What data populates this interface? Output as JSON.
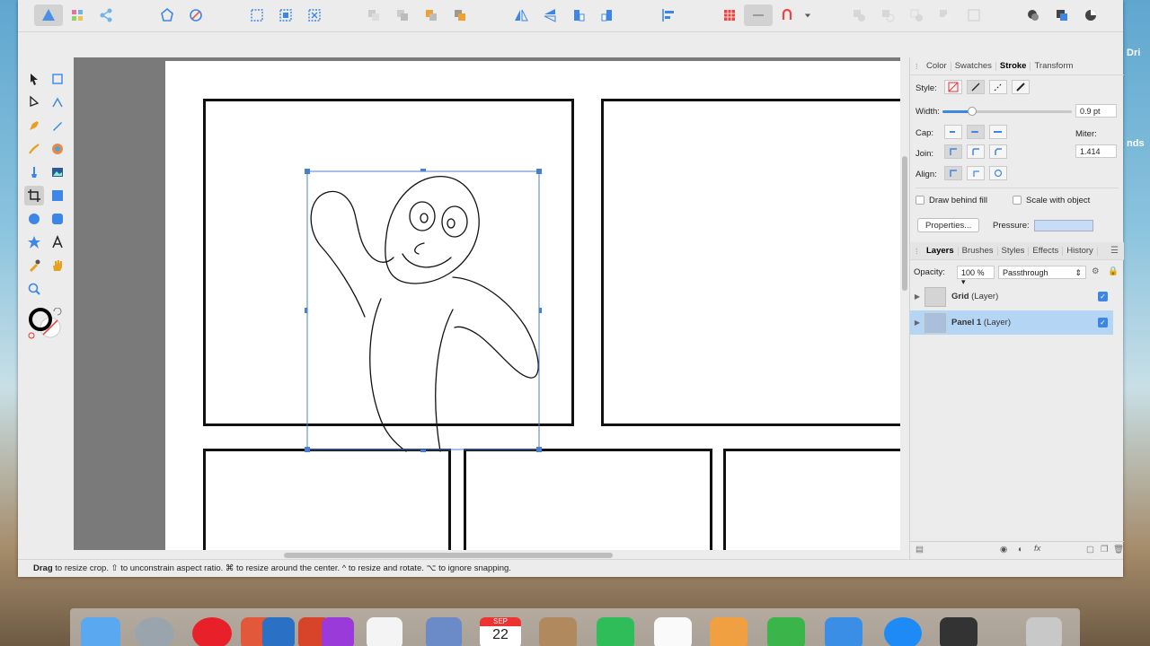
{
  "desktop": {
    "right_text_1": "Dri",
    "right_text_2": "nds"
  },
  "toolbar": {
    "icons": [
      "affinity-designer-icon",
      "pixel-persona-icon",
      "export-persona-icon",
      "assistant-icon",
      "preferences-icon",
      "snapping-icon",
      "isolate-icon",
      "align-icon",
      "arrange-icon",
      "flip-icon",
      "boolean-icon",
      "insert-icon"
    ]
  },
  "tools": [
    "move-tool-icon",
    "artboard-tool-icon",
    "node-tool-icon",
    "corner-tool-icon",
    "pen-tool-icon",
    "pencil-tool-icon",
    "vector-brush-icon",
    "color-picker-icon",
    "fill-tool-icon",
    "place-image-icon",
    "crop-tool-icon",
    "rectangle-tool-icon",
    "ellipse-tool-icon",
    "rounded-rectangle-icon",
    "star-tool-icon",
    "text-tool-icon",
    "eyedropper-icon",
    "hand-tool-icon",
    "zoom-tool-icon"
  ],
  "status": {
    "bold": "Drag",
    "text": " to resize crop. ⇧ to unconstrain aspect ratio. ⌘ to resize around the center. ^ to resize and rotate. ⌥ to ignore snapping."
  },
  "stroke_panel": {
    "tabs": [
      "Color",
      "Swatches",
      "Stroke",
      "Transform"
    ],
    "selected_tab": "Stroke",
    "style_label": "Style:",
    "width_label": "Width:",
    "width_value": "0.9 pt",
    "width_fraction": 0.23,
    "cap_label": "Cap:",
    "join_label": "Join:",
    "align_label": "Align:",
    "miter_label": "Miter:",
    "miter_value": "1.414",
    "draw_behind_fill": "Draw behind fill",
    "scale_with_object": "Scale with object",
    "properties_button": "Properties...",
    "pressure_label": "Pressure:"
  },
  "layers_panel": {
    "tabs": [
      "Layers",
      "Brushes",
      "Styles",
      "Effects",
      "History"
    ],
    "selected_tab": "Layers",
    "opacity_label": "Opacity:",
    "opacity_value": "100 %",
    "blend_mode": "Passthrough",
    "layers": [
      {
        "name": "Grid",
        "type": "(Layer)",
        "visible": true,
        "selected": false
      },
      {
        "name": "Panel 1",
        "type": "(Layer)",
        "visible": true,
        "selected": true
      }
    ]
  },
  "dock": {
    "dock_apps": [
      "finder-icon",
      "launchpad-icon",
      "opera-icon",
      "affinity-beta-icon",
      "affinity-designer-icon",
      "affinity-photo-beta-icon",
      "affinity-photo-icon",
      "textedit-icon",
      "preview-icon",
      "calendar-icon",
      "contacts-icon",
      "evernote-icon",
      "reminders-icon",
      "pages-icon",
      "numbers-icon",
      "keynote-icon",
      "app-store-icon",
      "photos-icon",
      "trash-icon"
    ],
    "calendar_month": "SEP",
    "calendar_day": "22"
  },
  "colors": {
    "accent": "#3d86e6",
    "selection": "#b5d5f5",
    "canvas_bg": "#7a7a7a"
  }
}
